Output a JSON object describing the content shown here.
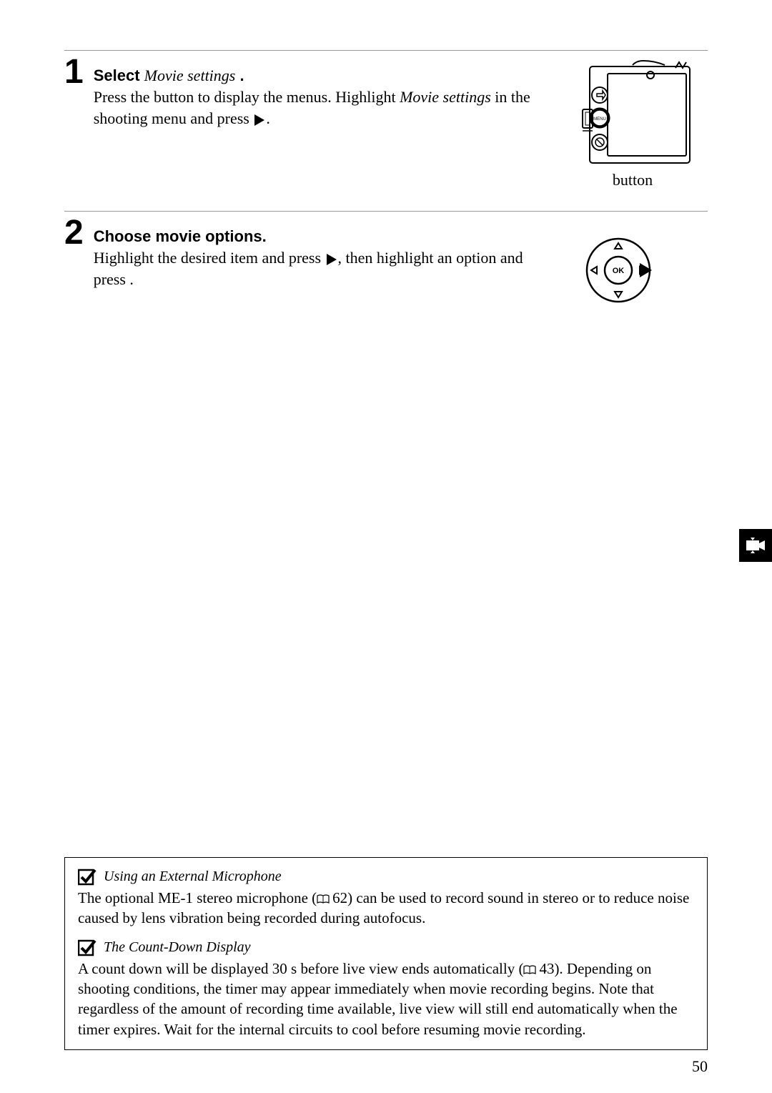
{
  "page_number": "50",
  "step1": {
    "number": "1",
    "title_prefix": "Select",
    "title_italic": "Movie settings",
    "title_suffix": ".",
    "body_1": "Press the ",
    "body_2": " button to display the menus. Highlight ",
    "body_italic": "Movie settings",
    "body_3": " in the shooting menu and press ",
    "body_4": ".",
    "caption": "button"
  },
  "step2": {
    "number": "2",
    "title": "Choose movie options.",
    "body_1": "Highlight the desired item and press ",
    "body_2": ", then highlight an option and press ",
    "body_3": "."
  },
  "note1": {
    "title": "Using an External Microphone",
    "body_a": "The optional ME-1 stereo microphone (",
    "ref": "62",
    "body_b": ") can be used to record sound in stereo or to reduce noise caused by lens vibration being recorded during autofocus."
  },
  "note2": {
    "title": "The Count-Down Display",
    "body_a": "A count down will be displayed 30 s before live view ends automatically (",
    "ref": "43",
    "body_b": "). Depending on shooting conditions, the timer may appear immediately when movie recording begins. Note that regardless of the amount of recording time available, live view will still end automatically when the timer expires. Wait for the internal circuits to cool before resuming movie recording."
  },
  "ok_label": "OK"
}
